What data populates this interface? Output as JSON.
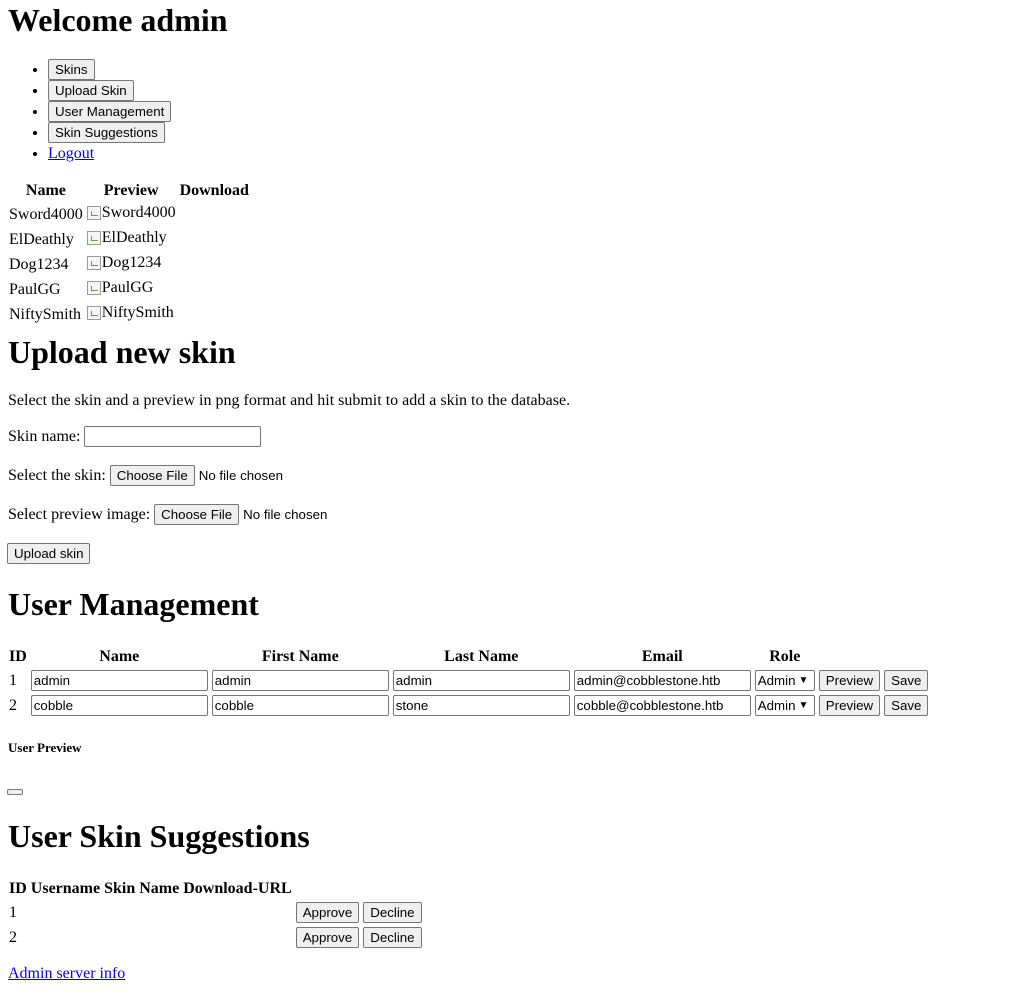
{
  "header": {
    "title": "Welcome admin"
  },
  "nav": {
    "items": [
      {
        "label": "Skins",
        "kind": "button"
      },
      {
        "label": "Upload Skin",
        "kind": "button"
      },
      {
        "label": "User Management",
        "kind": "button"
      },
      {
        "label": "Skin Suggestions",
        "kind": "button"
      },
      {
        "label": "Logout",
        "kind": "link"
      }
    ]
  },
  "skins": {
    "headers": [
      "Name",
      "Preview",
      "Download"
    ],
    "rows": [
      {
        "name": "Sword4000",
        "preview_alt": "Sword4000"
      },
      {
        "name": "ElDeathly",
        "preview_alt": "ElDeathly"
      },
      {
        "name": "Dog1234",
        "preview_alt": "Dog1234"
      },
      {
        "name": "PaulGG",
        "preview_alt": "PaulGG"
      },
      {
        "name": "NiftySmith",
        "preview_alt": "NiftySmith"
      }
    ]
  },
  "upload": {
    "title": "Upload new skin",
    "description": "Select the skin and a preview in png format and hit submit to add a skin to the database.",
    "name_label": "Skin name:",
    "name_value": "",
    "skin_label": "Select the skin:",
    "preview_label": "Select preview image:",
    "choose_file": "Choose File",
    "no_file": "No file chosen",
    "submit_label": "Upload skin"
  },
  "users": {
    "title": "User Management",
    "headers": [
      "ID",
      "Name",
      "First Name",
      "Last Name",
      "Email",
      "Role"
    ],
    "rows": [
      {
        "id": "1",
        "name": "admin",
        "first": "admin",
        "last": "admin",
        "email": "admin@cobblestone.htb",
        "role": "Admin"
      },
      {
        "id": "2",
        "name": "cobble",
        "first": "cobble",
        "last": "stone",
        "email": "cobble@cobblestone.htb",
        "role": "Admin"
      }
    ],
    "preview_label": "Preview",
    "save_label": "Save",
    "user_preview_title": "User Preview"
  },
  "suggestions": {
    "title": "User Skin Suggestions",
    "headers": [
      "ID",
      "Username",
      "Skin Name",
      "Download-URL"
    ],
    "rows": [
      {
        "id": "1"
      },
      {
        "id": "2"
      }
    ],
    "approve_label": "Approve",
    "decline_label": "Decline"
  },
  "footer": {
    "link": "Admin server info"
  }
}
